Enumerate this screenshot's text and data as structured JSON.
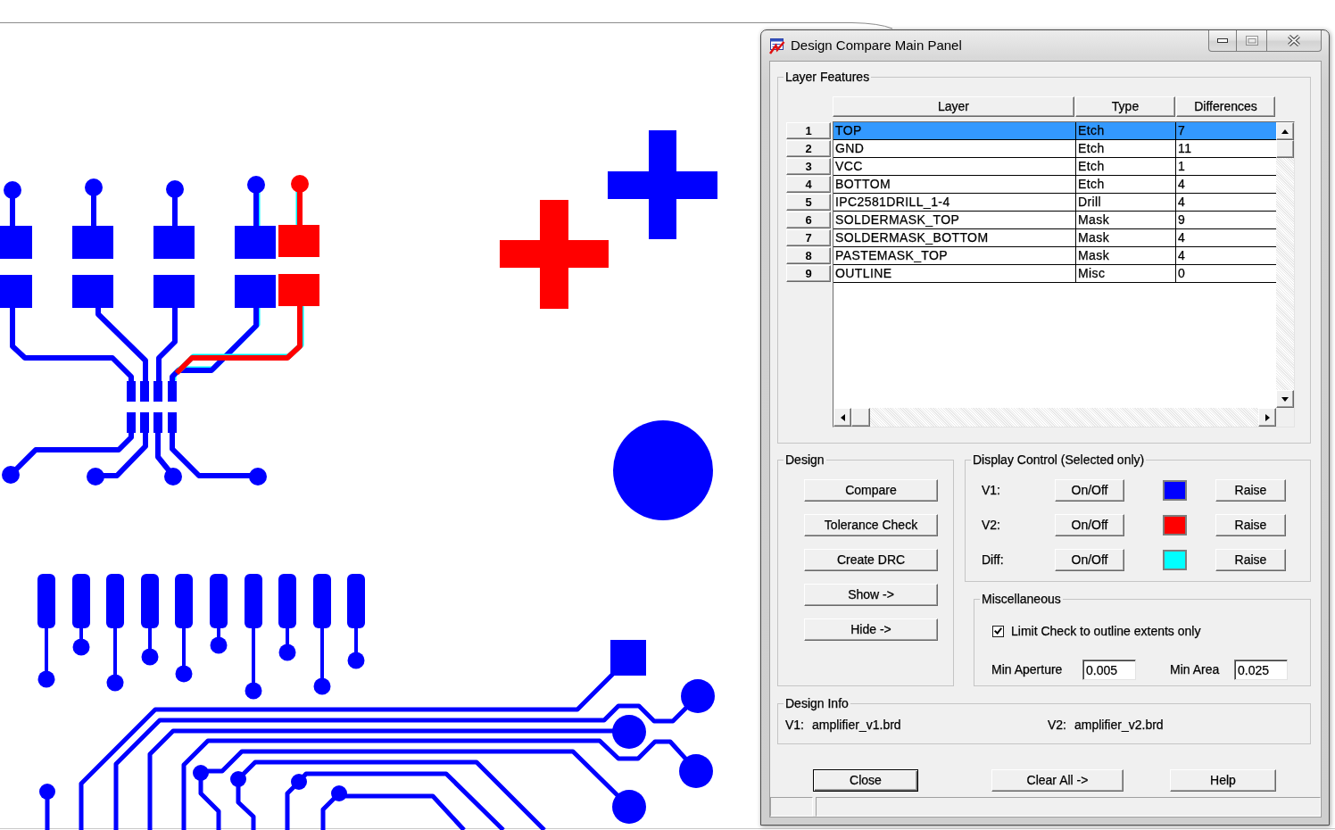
{
  "window": {
    "title": "Design Compare Main Panel",
    "maximize_disabled": true
  },
  "layer_features": {
    "title": "Layer Features",
    "columns": [
      "Layer",
      "Type",
      "Differences"
    ],
    "rows": [
      {
        "number": "1",
        "layer": "TOP",
        "type": "Etch",
        "differences": "7",
        "selected": true
      },
      {
        "number": "2",
        "layer": "GND",
        "type": "Etch",
        "differences": "11",
        "selected": false
      },
      {
        "number": "3",
        "layer": "VCC",
        "type": "Etch",
        "differences": "1",
        "selected": false
      },
      {
        "number": "4",
        "layer": "BOTTOM",
        "type": "Etch",
        "differences": "4",
        "selected": false
      },
      {
        "number": "5",
        "layer": "IPC2581DRILL_1-4",
        "type": "Drill",
        "differences": "4",
        "selected": false
      },
      {
        "number": "6",
        "layer": "SOLDERMASK_TOP",
        "type": "Mask",
        "differences": "9",
        "selected": false
      },
      {
        "number": "7",
        "layer": "SOLDERMASK_BOTTOM",
        "type": "Mask",
        "differences": "4",
        "selected": false
      },
      {
        "number": "8",
        "layer": "PASTEMASK_TOP",
        "type": "Mask",
        "differences": "4",
        "selected": false
      },
      {
        "number": "9",
        "layer": "OUTLINE",
        "type": "Misc",
        "differences": "0",
        "selected": false
      }
    ]
  },
  "design": {
    "title": "Design",
    "buttons": [
      "Compare",
      "Tolerance Check",
      "Create DRC",
      "Show ->",
      "Hide ->"
    ]
  },
  "display_control": {
    "title": "Display Control (Selected only)",
    "rows": [
      {
        "label": "V1:",
        "toggle": "On/Off",
        "color": "#0000ff",
        "raise": "Raise"
      },
      {
        "label": "V2:",
        "toggle": "On/Off",
        "color": "#ff0000",
        "raise": "Raise"
      },
      {
        "label": "Diff:",
        "toggle": "On/Off",
        "color": "#00ffff",
        "raise": "Raise"
      }
    ]
  },
  "miscellaneous": {
    "title": "Miscellaneous",
    "checkbox": {
      "label": "Limit Check to outline extents only",
      "checked": true
    },
    "fields": [
      {
        "label": "Min Aperture",
        "value": "0.005"
      },
      {
        "label": "Min Area",
        "value": "0.025"
      }
    ]
  },
  "design_info": {
    "title": "Design Info",
    "items": [
      {
        "label": "V1:",
        "value": "amplifier_v1.brd"
      },
      {
        "label": "V2:",
        "value": "amplifier_v2.brd"
      }
    ]
  },
  "buttons": [
    {
      "label": "Close",
      "default": true
    },
    {
      "label": "Clear All ->",
      "default": false
    },
    {
      "label": "Help",
      "default": false
    }
  ]
}
